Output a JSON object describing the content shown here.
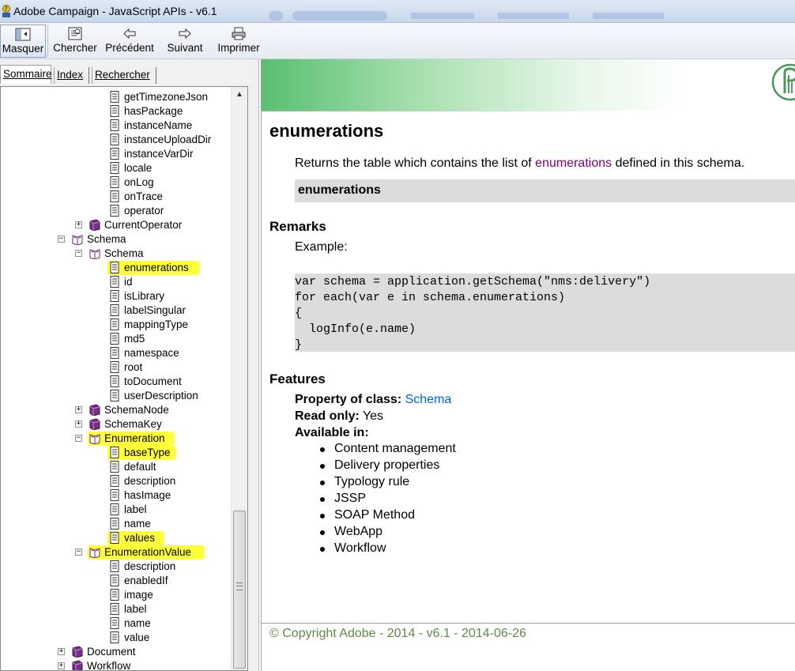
{
  "window": {
    "title": "Adobe Campaign - JavaScript APIs - v6.1"
  },
  "toolbar": {
    "hide": "Masquer",
    "search": "Chercher",
    "back": "Précédent",
    "forward": "Suivant",
    "print": "Imprimer"
  },
  "tabs": {
    "contents": "Sommaire",
    "index": "Index",
    "search": "Rechercher"
  },
  "tree": [
    {
      "label": "getTimezoneJson",
      "type": "page",
      "level": 3
    },
    {
      "label": "hasPackage",
      "type": "page",
      "level": 3
    },
    {
      "label": "instanceName",
      "type": "page",
      "level": 3
    },
    {
      "label": "instanceUploadDir",
      "type": "page",
      "level": 3
    },
    {
      "label": "instanceVarDir",
      "type": "page",
      "level": 3
    },
    {
      "label": "locale",
      "type": "page",
      "level": 3
    },
    {
      "label": "onLog",
      "type": "page",
      "level": 3
    },
    {
      "label": "onTrace",
      "type": "page",
      "level": 3
    },
    {
      "label": "operator",
      "type": "page",
      "level": 3
    },
    {
      "label": "CurrentOperator",
      "type": "book",
      "level": 2,
      "expander": "+"
    },
    {
      "label": "Schema",
      "type": "book-open",
      "level": 1,
      "expander": "-"
    },
    {
      "label": "Schema",
      "type": "book-open",
      "level": 2,
      "expander": "-"
    },
    {
      "label": "enumerations",
      "type": "page",
      "level": 3,
      "highlight": true
    },
    {
      "label": "id",
      "type": "page",
      "level": 3
    },
    {
      "label": "isLibrary",
      "type": "page",
      "level": 3
    },
    {
      "label": "labelSingular",
      "type": "page",
      "level": 3
    },
    {
      "label": "mappingType",
      "type": "page",
      "level": 3
    },
    {
      "label": "md5",
      "type": "page",
      "level": 3
    },
    {
      "label": "namespace",
      "type": "page",
      "level": 3
    },
    {
      "label": "root",
      "type": "page",
      "level": 3
    },
    {
      "label": "toDocument",
      "type": "page",
      "level": 3
    },
    {
      "label": "userDescription",
      "type": "page",
      "level": 3
    },
    {
      "label": "SchemaNode",
      "type": "book",
      "level": 2,
      "expander": "+"
    },
    {
      "label": "SchemaKey",
      "type": "book",
      "level": 2,
      "expander": "+"
    },
    {
      "label": "Enumeration",
      "type": "book-open",
      "level": 2,
      "expander": "-",
      "highlight": true
    },
    {
      "label": "baseType",
      "type": "page",
      "level": 3,
      "highlight": true
    },
    {
      "label": "default",
      "type": "page",
      "level": 3
    },
    {
      "label": "description",
      "type": "page",
      "level": 3
    },
    {
      "label": "hasImage",
      "type": "page",
      "level": 3
    },
    {
      "label": "label",
      "type": "page",
      "level": 3
    },
    {
      "label": "name",
      "type": "page",
      "level": 3
    },
    {
      "label": "values",
      "type": "page",
      "level": 3,
      "highlight": true
    },
    {
      "label": "EnumerationValue",
      "type": "book-open",
      "level": 2,
      "expander": "-",
      "highlight": true
    },
    {
      "label": "description",
      "type": "page",
      "level": 3
    },
    {
      "label": "enabledIf",
      "type": "page",
      "level": 3
    },
    {
      "label": "image",
      "type": "page",
      "level": 3
    },
    {
      "label": "label",
      "type": "page",
      "level": 3
    },
    {
      "label": "name",
      "type": "page",
      "level": 3
    },
    {
      "label": "value",
      "type": "page",
      "level": 3
    },
    {
      "label": "Document",
      "type": "book",
      "level": 1,
      "expander": "+"
    },
    {
      "label": "Workflow",
      "type": "book",
      "level": 1,
      "expander": "+"
    }
  ],
  "content": {
    "title": "enumerations",
    "desc_before": "Returns the table which contains the list of ",
    "desc_link": "enumerations",
    "desc_after": " defined in this schema.",
    "signature": "enumerations",
    "remarks_heading": "Remarks",
    "example_label": "Example:",
    "code": "var schema = application.getSchema(\"nms:delivery\")\nfor each(var e in schema.enumerations)\n{\n  logInfo(e.name)\n}",
    "features_heading": "Features",
    "property_label": "Property of class:",
    "property_value": "Schema",
    "readonly_label": "Read only:",
    "readonly_value": "Yes",
    "available_label": "Available in:",
    "available": [
      "Content management",
      "Delivery properties",
      "Typology rule",
      "JSSP",
      "SOAP Method",
      "WebApp",
      "Workflow"
    ],
    "copyright": "© Copyright Adobe - 2014 - v6.1 - 2014-06-26"
  },
  "colors": {
    "highlight": "#ffff3a",
    "link_visited": "#800080",
    "link": "#0066cc",
    "banner_green": "#58c070",
    "footer_text": "#5f8a45"
  }
}
